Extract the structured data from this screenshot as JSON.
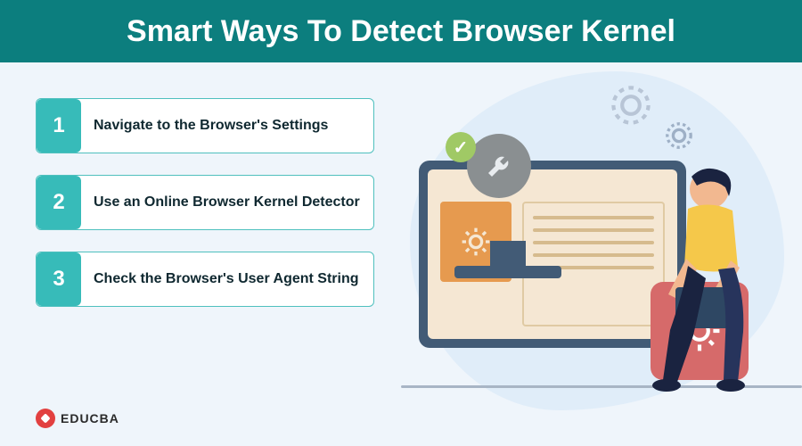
{
  "header": {
    "title": "Smart Ways To Detect Browser Kernel"
  },
  "steps": [
    {
      "num": "1",
      "label": "Navigate to the Browser's Settings"
    },
    {
      "num": "2",
      "label": "Use an Online Browser Kernel Detector"
    },
    {
      "num": "3",
      "label": "Check the Browser's User Agent String"
    }
  ],
  "brand": {
    "name": "EDUCBA"
  },
  "icons": {
    "gear_big": "gear-icon",
    "gear_small": "gear-icon",
    "wrench": "wrench-icon",
    "check": "✓"
  },
  "colors": {
    "accent": "#0c7e7e",
    "teal": "#37bbb9",
    "bg": "#eff5fb",
    "orange": "#e69a4f",
    "navy": "#425b76",
    "red": "#d66a6a"
  }
}
